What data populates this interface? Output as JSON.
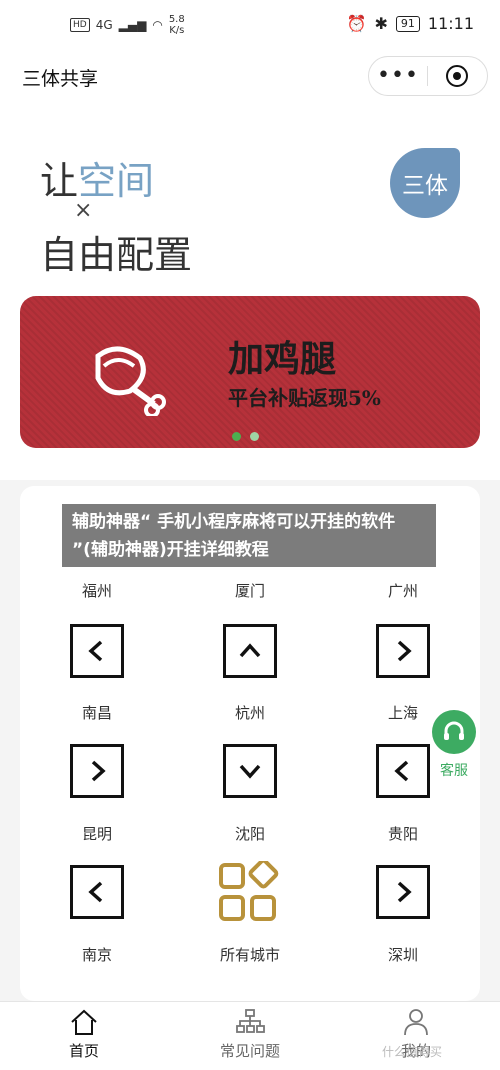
{
  "status_bar": {
    "hd_badge": "HD",
    "network": "4G",
    "speed_value": "5.8",
    "speed_unit": "K/s",
    "battery": "91",
    "time": "11:11"
  },
  "navbar": {
    "title": "三体共享",
    "more_label": "•••"
  },
  "hero": {
    "slogan_prefix": "让",
    "slogan_highlight": "空间",
    "slogan_times": "×",
    "slogan_line2": "自由配置",
    "logo_text": "三体"
  },
  "banner": {
    "title": "加鸡腿",
    "subtitle": "平台补贴返现5%",
    "slides": 2,
    "active_slide": 1
  },
  "overlay": {
    "text": "辅助神器“ 手机小程序麻将可以开挂的软件 ”(辅助神器)开挂详细教程"
  },
  "cities": {
    "row1": [
      "福州",
      "厦门",
      "广州"
    ],
    "icons_row1": [
      "chevron-left",
      "chevron-up",
      "chevron-right"
    ],
    "row2": [
      "南昌",
      "杭州",
      "上海"
    ],
    "icons_row2": [
      "chevron-right",
      "chevron-down",
      "chevron-left"
    ],
    "row3": [
      "昆明",
      "沈阳",
      "贵阳"
    ],
    "icons_row3": [
      "chevron-left",
      "grid",
      "chevron-right"
    ],
    "row4": [
      "南京",
      "所有城市",
      "深圳"
    ]
  },
  "service": {
    "label": "客服"
  },
  "tabbar": {
    "tabs": [
      {
        "label": "首页",
        "icon": "home-icon",
        "active": true
      },
      {
        "label": "常见问题",
        "icon": "sitemap-icon",
        "active": false
      },
      {
        "label": "我的",
        "icon": "user-icon",
        "active": false
      }
    ]
  },
  "watermark": "什么值得买",
  "colors": {
    "accent_green": "#3dab62",
    "banner_red": "#b6313a",
    "logo_blue": "#6e95bb",
    "grid_gold": "#b8923b"
  }
}
